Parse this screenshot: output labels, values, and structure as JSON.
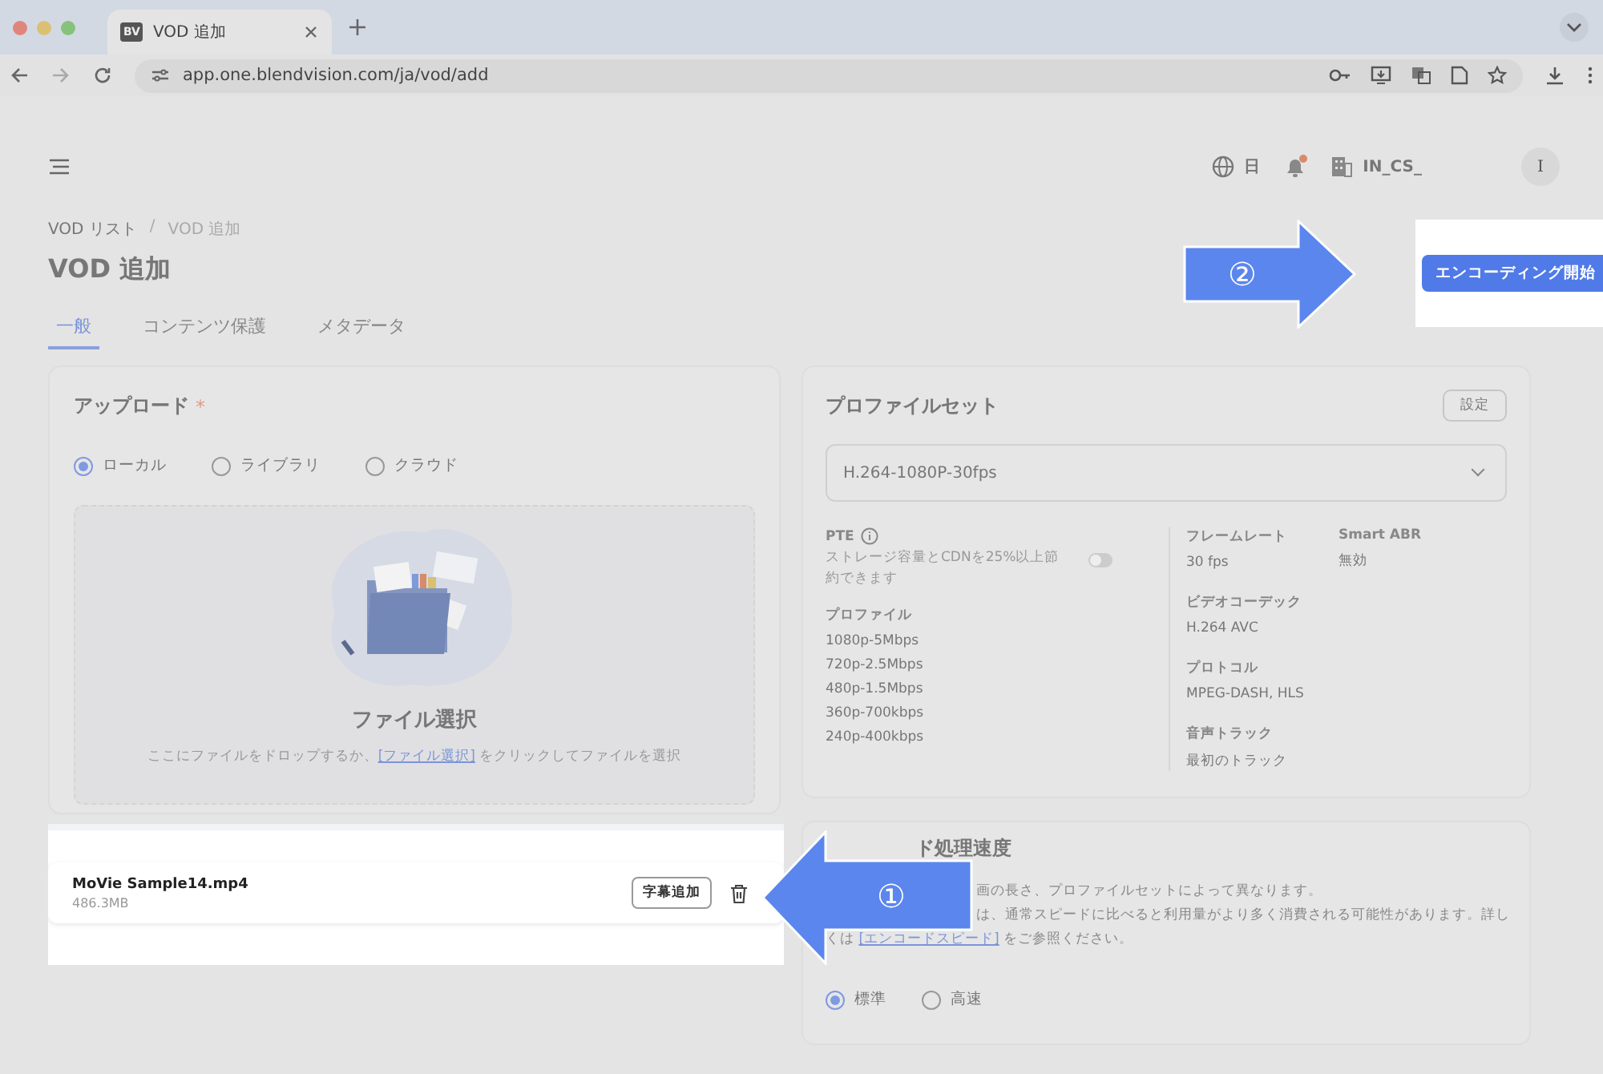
{
  "browser": {
    "tab_logo": "BV",
    "tab_title": "VOD 追加",
    "url": "app.one.blendvision.com/ja/vod/add"
  },
  "header": {
    "language": "日",
    "has_notification": true,
    "organization": "IN_CS_",
    "avatar": "I"
  },
  "breadcrumb": [
    "VOD リスト",
    "VOD 追加"
  ],
  "breadcrumb_separator": "/",
  "title": "VOD 追加",
  "tabs": [
    {
      "label": "一般",
      "selected": true
    },
    {
      "label": "コンテンツ保護",
      "selected": false
    },
    {
      "label": "メタデータ",
      "selected": false
    }
  ],
  "start_button": "エンコーディング開始",
  "callouts": [
    {
      "number": "②"
    },
    {
      "number": "①"
    }
  ],
  "upload": {
    "title": "アップロード",
    "required_mark": "*",
    "sources": [
      {
        "label": "ローカル",
        "selected": true
      },
      {
        "label": "ライブラリ",
        "selected": false
      },
      {
        "label": "クラウド",
        "selected": false
      }
    ],
    "dropzone": {
      "title": "ファイル選択",
      "hint_before": "ここにファイルをドロップするか、",
      "link": "[ファイル選択]",
      "hint_after": " をクリックしてファイルを選択"
    },
    "file": {
      "name": "MoVie Sample14.mp4",
      "size": "486.3MB",
      "subtitle_button": "字幕追加"
    }
  },
  "profile": {
    "title": "プロファイルセット",
    "settings_button": "設定",
    "select_value": "H.264-1080P-30fps",
    "pte": {
      "label": "PTE",
      "description": "ストレージ容量とCDNを25%以上節約できます",
      "on": false
    },
    "profiles_label": "プロファイル",
    "profiles": [
      "1080p-5Mbps",
      "720p-2.5Mbps",
      "480p-1.5Mbps",
      "360p-700kbps",
      "240p-400kbps"
    ],
    "specs": [
      {
        "label": "フレームレート",
        "value": "30 fps"
      },
      {
        "label": "ビデオコーデック",
        "value": "H.264 AVC"
      },
      {
        "label": "プロトコル",
        "value": "MPEG-DASH, HLS"
      },
      {
        "label": "音声トラック",
        "value": "最初のトラック"
      }
    ],
    "smart_abr": {
      "label": "Smart ABR",
      "value": "無効"
    }
  },
  "encode_speed": {
    "title_fragment": "ド処理速度",
    "line_1": "画の長さ、プロファイルセットによって異なります。",
    "line_2": "は、通常スピードに比べると利用量がより多く消費される可能性があります。詳し",
    "line_3_before": "くは ",
    "link": "[エンコードスピード]",
    "line_3_after": " をご参照ください。",
    "options": [
      {
        "label": "標準",
        "selected": true
      },
      {
        "label": "高速",
        "selected": false
      }
    ]
  }
}
